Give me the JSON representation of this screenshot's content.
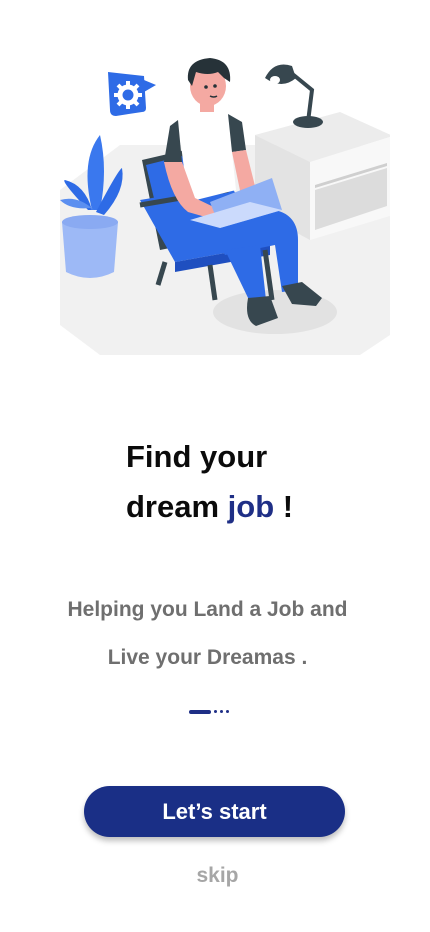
{
  "onboarding": {
    "title_line1": "Find your",
    "title_line2_prefix": "dream",
    "title_highlight": "job",
    "title_suffix": "!",
    "subtitle_line1": "Helping you Land a Job and",
    "subtitle_line2": "Live your Dreamas .",
    "pager": {
      "current": 1,
      "total": 4
    },
    "start_label": "Let’s start",
    "skip_label": "skip"
  },
  "colors": {
    "accent": "#1a2f86",
    "title": "#0b0b0b",
    "subtitle": "#6f6f6f",
    "skip": "#a6a6a6"
  },
  "icons": [
    "gear-icon"
  ]
}
